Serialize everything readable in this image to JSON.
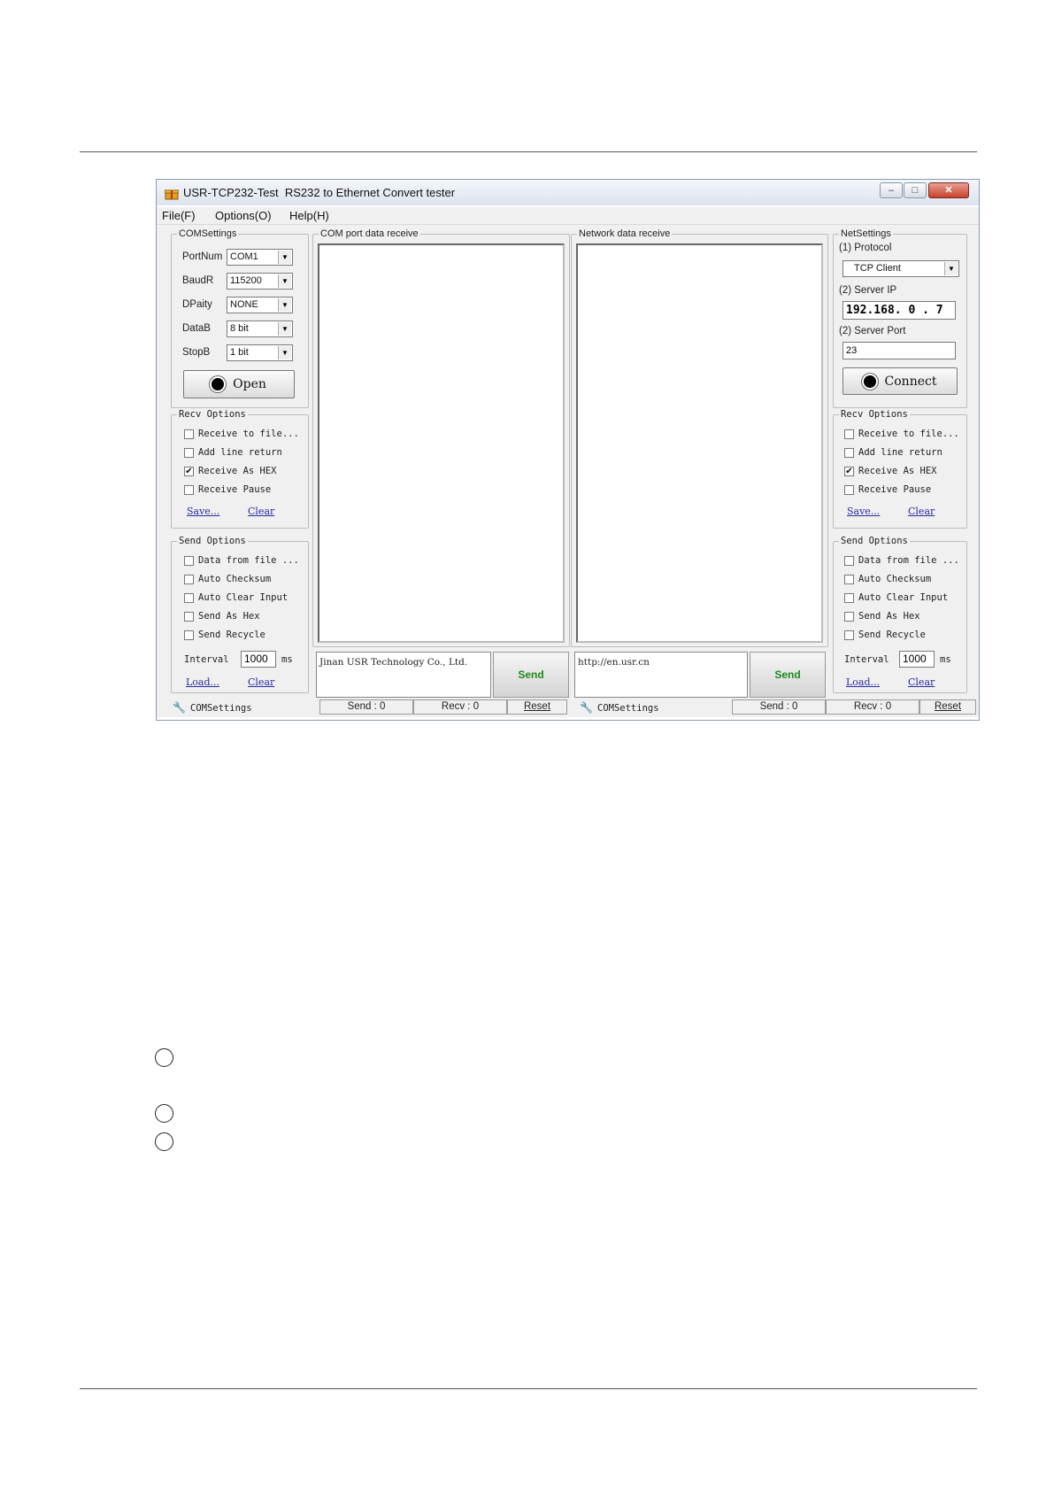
{
  "window": {
    "title": "USR-TCP232-Test  RS232 to Ethernet Convert tester",
    "controls": {
      "minimize": "–",
      "maximize": "□",
      "close": "✕"
    }
  },
  "menu": [
    "File(F)",
    "Options(O)",
    "Help(H)"
  ],
  "com_settings": {
    "title": "COMSettings",
    "fields": [
      {
        "label": "PortNum",
        "value": "COM1"
      },
      {
        "label": "BaudR",
        "value": "115200"
      },
      {
        "label": "DPaity",
        "value": "NONE"
      },
      {
        "label": "DataB",
        "value": "8 bit"
      },
      {
        "label": "StopB",
        "value": "1 bit"
      }
    ],
    "open_button": "Open"
  },
  "recv_options_left": {
    "title": "Recv Options",
    "options": [
      {
        "label": "Receive to file...",
        "checked": false
      },
      {
        "label": "Add line return",
        "checked": false
      },
      {
        "label": "Receive As HEX",
        "checked": true
      },
      {
        "label": "Receive Pause",
        "checked": false
      }
    ],
    "save": "Save...",
    "clear": "Clear"
  },
  "send_options_left": {
    "title": "Send Options",
    "options": [
      {
        "label": "Data from file ...",
        "checked": false
      },
      {
        "label": "Auto Checksum",
        "checked": false
      },
      {
        "label": "Auto Clear Input",
        "checked": false
      },
      {
        "label": "Send As Hex",
        "checked": false
      },
      {
        "label": "Send Recycle",
        "checked": false
      }
    ],
    "interval_label": "Interval",
    "interval_value": "1000",
    "interval_unit": "ms",
    "load": "Load...",
    "clear": "Clear"
  },
  "com_receive": {
    "title": "COM port data receive"
  },
  "net_receive": {
    "title": "Network data receive"
  },
  "com_send": {
    "text": "Jinan USR Technology Co., Ltd.",
    "button": "Send"
  },
  "net_send": {
    "text": "http://en.usr.cn",
    "button": "Send"
  },
  "net_settings": {
    "title": "NetSettings",
    "protocol_label": "(1) Protocol",
    "protocol_value": "TCP Client",
    "server_ip_label": "(2) Server IP",
    "server_ip_value": "192.168. 0 . 7",
    "server_port_label": "(2) Server Port",
    "server_port_value": "23",
    "connect_button": "Connect"
  },
  "recv_options_right": {
    "title": "Recv Options",
    "options": [
      {
        "label": "Receive to file...",
        "checked": false
      },
      {
        "label": "Add line return",
        "checked": false
      },
      {
        "label": "Receive As HEX",
        "checked": true
      },
      {
        "label": "Receive Pause",
        "checked": false
      }
    ],
    "save": "Save...",
    "clear": "Clear"
  },
  "send_options_right": {
    "title": "Send Options",
    "options": [
      {
        "label": "Data from file ...",
        "checked": false
      },
      {
        "label": "Auto Checksum",
        "checked": false
      },
      {
        "label": "Auto Clear Input",
        "checked": false
      },
      {
        "label": "Send As Hex",
        "checked": false
      },
      {
        "label": "Send Recycle",
        "checked": false
      }
    ],
    "interval_label": "Interval",
    "interval_value": "1000",
    "interval_unit": "ms",
    "load": "Load...",
    "clear": "Clear"
  },
  "status_left": {
    "label": "COMSettings",
    "send": "Send : 0",
    "recv": "Recv : 0",
    "reset": "Reset"
  },
  "status_right": {
    "label": "COMSettings",
    "send": "Send : 0",
    "recv": "Recv : 0",
    "reset": "Reset"
  },
  "icons": {
    "app": "gift-box-icon",
    "status": "settings-wand-icon",
    "check": "✔",
    "dropdown": "▼"
  }
}
